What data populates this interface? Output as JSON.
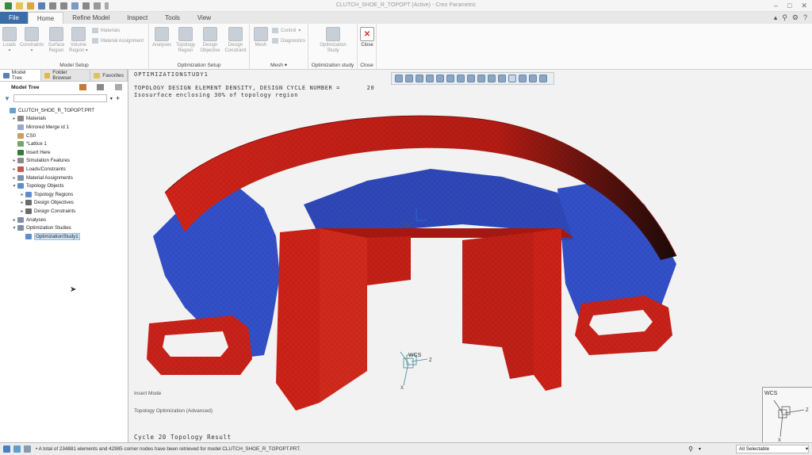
{
  "window": {
    "title": "CLUTCH_SHOE_R_TOPOPT (Active) - Creo Parametric"
  },
  "ribbon_tabs": [
    "File",
    "Home",
    "Refine Model",
    "Inspect",
    "Tools",
    "View"
  ],
  "ribbon": {
    "model_setup": {
      "label": "Model Setup",
      "loads": "Loads",
      "constraints": "Constraints",
      "surface_region": "Surface Region",
      "volume_region": "Volume Region",
      "materials": "Materials",
      "material_assignment": "Material Assignment"
    },
    "optimization_setup": {
      "label": "Optimization Setup",
      "analyses": "Analyses",
      "topology_region": "Topology Region",
      "design_objective": "Design Objective",
      "design_constraint": "Design Constraint"
    },
    "mesh": {
      "label": "Mesh",
      "mesh": "Mesh",
      "control": "Control",
      "diagnostics": "Diagnostics"
    },
    "optimization_study": {
      "label": "Optimization study",
      "optimization_study": "Optimization Study"
    },
    "close": {
      "label": "Close",
      "close": "Close"
    }
  },
  "panel": {
    "tabs": [
      "Model Tree",
      "Folder Browser",
      "Favorites"
    ],
    "header": "Model Tree",
    "tree": [
      {
        "label": "CLUTCH_SHOE_R_TOPOPT.PRT",
        "depth": 0,
        "expander": "",
        "icon": "part-icon",
        "color": "#6aa0d0"
      },
      {
        "label": "Materials",
        "depth": 1,
        "expander": "▸",
        "icon": "materials-icon",
        "color": "#8a8a8a"
      },
      {
        "label": "Mirrored Merge id 1",
        "depth": 1,
        "expander": "",
        "icon": "merge-icon",
        "color": "#9aa9c9"
      },
      {
        "label": "CS0",
        "depth": 1,
        "expander": "",
        "icon": "csys-icon",
        "color": "#c9a15a"
      },
      {
        "label": "*Lattice 1",
        "depth": 1,
        "expander": "",
        "icon": "lattice-icon",
        "color": "#7aa36a"
      },
      {
        "label": "Insert Here",
        "depth": 1,
        "expander": "",
        "icon": "insert-icon",
        "color": "#2e7d32"
      },
      {
        "label": "Simulation Features",
        "depth": 1,
        "expander": "▸",
        "icon": "sim-features-icon",
        "color": "#8a8a8a"
      },
      {
        "label": "Loads/Constraints",
        "depth": 1,
        "expander": "▸",
        "icon": "loads-icon",
        "color": "#c25b4a"
      },
      {
        "label": "Material Assignments",
        "depth": 1,
        "expander": "▸",
        "icon": "material-assign-icon",
        "color": "#7f8fa6"
      },
      {
        "label": "Topology Objects",
        "depth": 1,
        "expander": "▾",
        "icon": "topology-icon",
        "color": "#5b8fc9"
      },
      {
        "label": "Topology Regions",
        "depth": 2,
        "expander": "▸",
        "icon": "topology-region-icon",
        "color": "#5b8fc9"
      },
      {
        "label": "Design Objectives",
        "depth": 2,
        "expander": "▸",
        "icon": "objective-icon",
        "color": "#6b6b6b"
      },
      {
        "label": "Design Constraints",
        "depth": 2,
        "expander": "▸",
        "icon": "constraint-icon",
        "color": "#6b6b6b"
      },
      {
        "label": "Analyses",
        "depth": 1,
        "expander": "▸",
        "icon": "analyses-icon",
        "color": "#7f8fa6"
      },
      {
        "label": "Optimization Studies",
        "depth": 1,
        "expander": "▾",
        "icon": "opt-studies-icon",
        "color": "#7f8fa6"
      },
      {
        "label": "OptimizationStudy1",
        "depth": 2,
        "expander": "",
        "icon": "opt-study-icon",
        "color": "#5b8fc9",
        "selected": true
      }
    ]
  },
  "viewport": {
    "study_name": "OPTIMIZATIONSTUDY1",
    "line1": "TOPOLOGY DESIGN ELEMENT DENSITY, DESIGN CYCLE NUMBER =       20",
    "line2": "Isosurface enclosing 30% of topology region",
    "cs_label": "CS0",
    "wcs_label": "WCS",
    "axis_x": "X",
    "axis_z": "Z",
    "insert_mode": "Insert Mode",
    "mode_note": "Topology Optimization (Advanced)",
    "result": "Cycle 20 Topology Result"
  },
  "status": {
    "message": "• A total of 234881 elements and 42985 corner nodes have been retrieved for model CLUTCH_SHOE_R_TOPOPT.PRT.",
    "selection_filter": "All Selectable"
  }
}
